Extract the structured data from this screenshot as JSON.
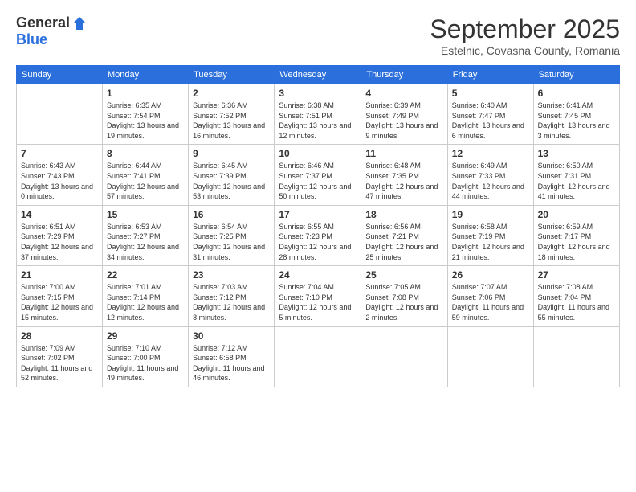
{
  "header": {
    "logo_general": "General",
    "logo_blue": "Blue",
    "month_title": "September 2025",
    "location": "Estelnic, Covasna County, Romania"
  },
  "days_of_week": [
    "Sunday",
    "Monday",
    "Tuesday",
    "Wednesday",
    "Thursday",
    "Friday",
    "Saturday"
  ],
  "weeks": [
    [
      {
        "day": "",
        "sunrise": "",
        "sunset": "",
        "daylight": ""
      },
      {
        "day": "1",
        "sunrise": "Sunrise: 6:35 AM",
        "sunset": "Sunset: 7:54 PM",
        "daylight": "Daylight: 13 hours and 19 minutes."
      },
      {
        "day": "2",
        "sunrise": "Sunrise: 6:36 AM",
        "sunset": "Sunset: 7:52 PM",
        "daylight": "Daylight: 13 hours and 16 minutes."
      },
      {
        "day": "3",
        "sunrise": "Sunrise: 6:38 AM",
        "sunset": "Sunset: 7:51 PM",
        "daylight": "Daylight: 13 hours and 12 minutes."
      },
      {
        "day": "4",
        "sunrise": "Sunrise: 6:39 AM",
        "sunset": "Sunset: 7:49 PM",
        "daylight": "Daylight: 13 hours and 9 minutes."
      },
      {
        "day": "5",
        "sunrise": "Sunrise: 6:40 AM",
        "sunset": "Sunset: 7:47 PM",
        "daylight": "Daylight: 13 hours and 6 minutes."
      },
      {
        "day": "6",
        "sunrise": "Sunrise: 6:41 AM",
        "sunset": "Sunset: 7:45 PM",
        "daylight": "Daylight: 13 hours and 3 minutes."
      }
    ],
    [
      {
        "day": "7",
        "sunrise": "Sunrise: 6:43 AM",
        "sunset": "Sunset: 7:43 PM",
        "daylight": "Daylight: 13 hours and 0 minutes."
      },
      {
        "day": "8",
        "sunrise": "Sunrise: 6:44 AM",
        "sunset": "Sunset: 7:41 PM",
        "daylight": "Daylight: 12 hours and 57 minutes."
      },
      {
        "day": "9",
        "sunrise": "Sunrise: 6:45 AM",
        "sunset": "Sunset: 7:39 PM",
        "daylight": "Daylight: 12 hours and 53 minutes."
      },
      {
        "day": "10",
        "sunrise": "Sunrise: 6:46 AM",
        "sunset": "Sunset: 7:37 PM",
        "daylight": "Daylight: 12 hours and 50 minutes."
      },
      {
        "day": "11",
        "sunrise": "Sunrise: 6:48 AM",
        "sunset": "Sunset: 7:35 PM",
        "daylight": "Daylight: 12 hours and 47 minutes."
      },
      {
        "day": "12",
        "sunrise": "Sunrise: 6:49 AM",
        "sunset": "Sunset: 7:33 PM",
        "daylight": "Daylight: 12 hours and 44 minutes."
      },
      {
        "day": "13",
        "sunrise": "Sunrise: 6:50 AM",
        "sunset": "Sunset: 7:31 PM",
        "daylight": "Daylight: 12 hours and 41 minutes."
      }
    ],
    [
      {
        "day": "14",
        "sunrise": "Sunrise: 6:51 AM",
        "sunset": "Sunset: 7:29 PM",
        "daylight": "Daylight: 12 hours and 37 minutes."
      },
      {
        "day": "15",
        "sunrise": "Sunrise: 6:53 AM",
        "sunset": "Sunset: 7:27 PM",
        "daylight": "Daylight: 12 hours and 34 minutes."
      },
      {
        "day": "16",
        "sunrise": "Sunrise: 6:54 AM",
        "sunset": "Sunset: 7:25 PM",
        "daylight": "Daylight: 12 hours and 31 minutes."
      },
      {
        "day": "17",
        "sunrise": "Sunrise: 6:55 AM",
        "sunset": "Sunset: 7:23 PM",
        "daylight": "Daylight: 12 hours and 28 minutes."
      },
      {
        "day": "18",
        "sunrise": "Sunrise: 6:56 AM",
        "sunset": "Sunset: 7:21 PM",
        "daylight": "Daylight: 12 hours and 25 minutes."
      },
      {
        "day": "19",
        "sunrise": "Sunrise: 6:58 AM",
        "sunset": "Sunset: 7:19 PM",
        "daylight": "Daylight: 12 hours and 21 minutes."
      },
      {
        "day": "20",
        "sunrise": "Sunrise: 6:59 AM",
        "sunset": "Sunset: 7:17 PM",
        "daylight": "Daylight: 12 hours and 18 minutes."
      }
    ],
    [
      {
        "day": "21",
        "sunrise": "Sunrise: 7:00 AM",
        "sunset": "Sunset: 7:15 PM",
        "daylight": "Daylight: 12 hours and 15 minutes."
      },
      {
        "day": "22",
        "sunrise": "Sunrise: 7:01 AM",
        "sunset": "Sunset: 7:14 PM",
        "daylight": "Daylight: 12 hours and 12 minutes."
      },
      {
        "day": "23",
        "sunrise": "Sunrise: 7:03 AM",
        "sunset": "Sunset: 7:12 PM",
        "daylight": "Daylight: 12 hours and 8 minutes."
      },
      {
        "day": "24",
        "sunrise": "Sunrise: 7:04 AM",
        "sunset": "Sunset: 7:10 PM",
        "daylight": "Daylight: 12 hours and 5 minutes."
      },
      {
        "day": "25",
        "sunrise": "Sunrise: 7:05 AM",
        "sunset": "Sunset: 7:08 PM",
        "daylight": "Daylight: 12 hours and 2 minutes."
      },
      {
        "day": "26",
        "sunrise": "Sunrise: 7:07 AM",
        "sunset": "Sunset: 7:06 PM",
        "daylight": "Daylight: 11 hours and 59 minutes."
      },
      {
        "day": "27",
        "sunrise": "Sunrise: 7:08 AM",
        "sunset": "Sunset: 7:04 PM",
        "daylight": "Daylight: 11 hours and 55 minutes."
      }
    ],
    [
      {
        "day": "28",
        "sunrise": "Sunrise: 7:09 AM",
        "sunset": "Sunset: 7:02 PM",
        "daylight": "Daylight: 11 hours and 52 minutes."
      },
      {
        "day": "29",
        "sunrise": "Sunrise: 7:10 AM",
        "sunset": "Sunset: 7:00 PM",
        "daylight": "Daylight: 11 hours and 49 minutes."
      },
      {
        "day": "30",
        "sunrise": "Sunrise: 7:12 AM",
        "sunset": "Sunset: 6:58 PM",
        "daylight": "Daylight: 11 hours and 46 minutes."
      },
      {
        "day": "",
        "sunrise": "",
        "sunset": "",
        "daylight": ""
      },
      {
        "day": "",
        "sunrise": "",
        "sunset": "",
        "daylight": ""
      },
      {
        "day": "",
        "sunrise": "",
        "sunset": "",
        "daylight": ""
      },
      {
        "day": "",
        "sunrise": "",
        "sunset": "",
        "daylight": ""
      }
    ]
  ]
}
